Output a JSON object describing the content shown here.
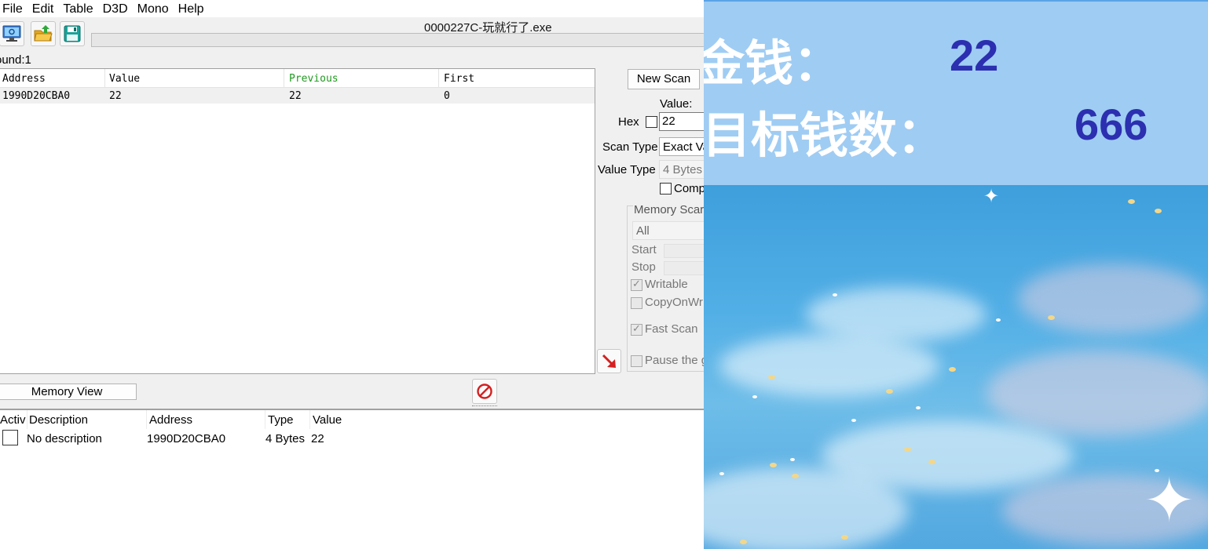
{
  "menu": [
    "File",
    "Edit",
    "Table",
    "D3D",
    "Mono",
    "Help"
  ],
  "process_title": "0000227C-玩就行了.exe",
  "found": "ound:1",
  "results": {
    "columns": [
      "Address",
      "Value",
      "Previous",
      "First"
    ],
    "rows": [
      {
        "address": "1990D20CBA0",
        "value": "22",
        "previous": "22",
        "first": "0"
      }
    ]
  },
  "scan_panel": {
    "new_scan": "New Scan",
    "value_label": "Value:",
    "hex_label": "Hex",
    "value_input": "22",
    "scan_type_label": "Scan Type",
    "scan_type_value": "Exact Va",
    "value_type_label": "Value Type",
    "value_type_value": "4 Bytes",
    "compare_label": "Comp",
    "memory_scan_label": "Memory Scar",
    "memory_region": "All",
    "start_label": "Start",
    "stop_label": "Stop",
    "writable_label": "Writable",
    "copyonwrite_label": "CopyOnWr",
    "fastscan_label": "Fast Scan",
    "pause_label": "Pause the g"
  },
  "memory_view_button": "Memory View",
  "address_list": {
    "columns": [
      "Activ",
      "Description",
      "Address",
      "Type",
      "Value"
    ],
    "rows": [
      {
        "description": "No description",
        "address": "1990D20CBA0",
        "type": "4 Bytes",
        "value": "22"
      }
    ]
  },
  "game": {
    "money_label": "金钱：",
    "money_value": "22",
    "target_label": "目标钱数：",
    "target_value": "666"
  }
}
